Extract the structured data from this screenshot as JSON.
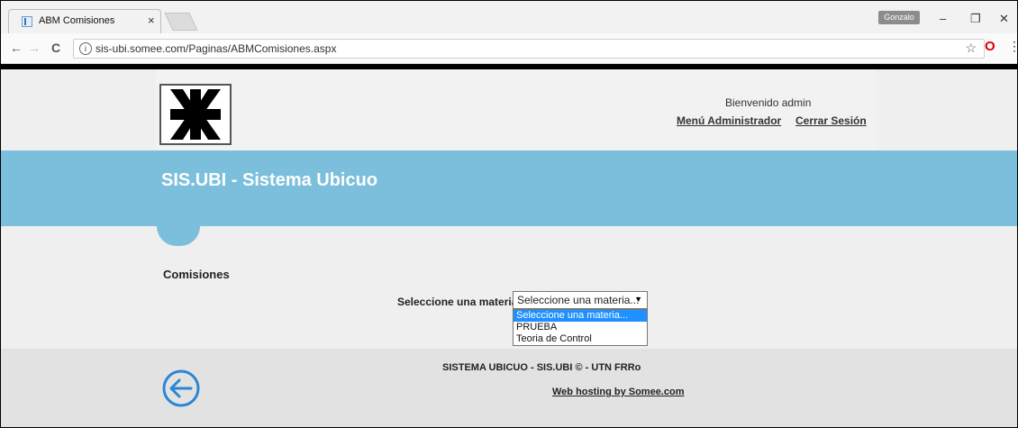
{
  "browser": {
    "tab_title": "ABM Comisiones",
    "tab_close": "×",
    "profile_name": "Gonzalo",
    "url": "sis-ubi.somee.com/Paginas/ABMComisiones.aspx",
    "min": "–",
    "restore": "❐",
    "close": "✕",
    "back": "←",
    "forward": "→",
    "reload": "C",
    "info": "i",
    "star": "☆",
    "opera": "O",
    "menu": "⋮"
  },
  "header": {
    "welcome": "Bienvenido admin",
    "admin_menu": "Menú Administrador",
    "logout": "Cerrar Sesión"
  },
  "banner": {
    "title": "SIS.UBI - Sistema Ubicuo"
  },
  "main": {
    "section_title": "Comisiones",
    "field_label": "Seleccione una materia:",
    "select_value": "Seleccione una materia...",
    "options": [
      "Seleccione una materia...",
      "PRUEBA",
      "Teoria de Control"
    ]
  },
  "footer": {
    "text": "SISTEMA UBICUO - SIS.UBI © - UTN FRRo",
    "hosting": "Web hosting by Somee.com"
  },
  "colors": {
    "banner": "#7bbfdc",
    "selected_option": "#1e90ff",
    "back_icon": "#2b86d6"
  },
  "icons": {
    "back": "back-arrow-circle-icon",
    "logo": "utn-logo-icon"
  }
}
